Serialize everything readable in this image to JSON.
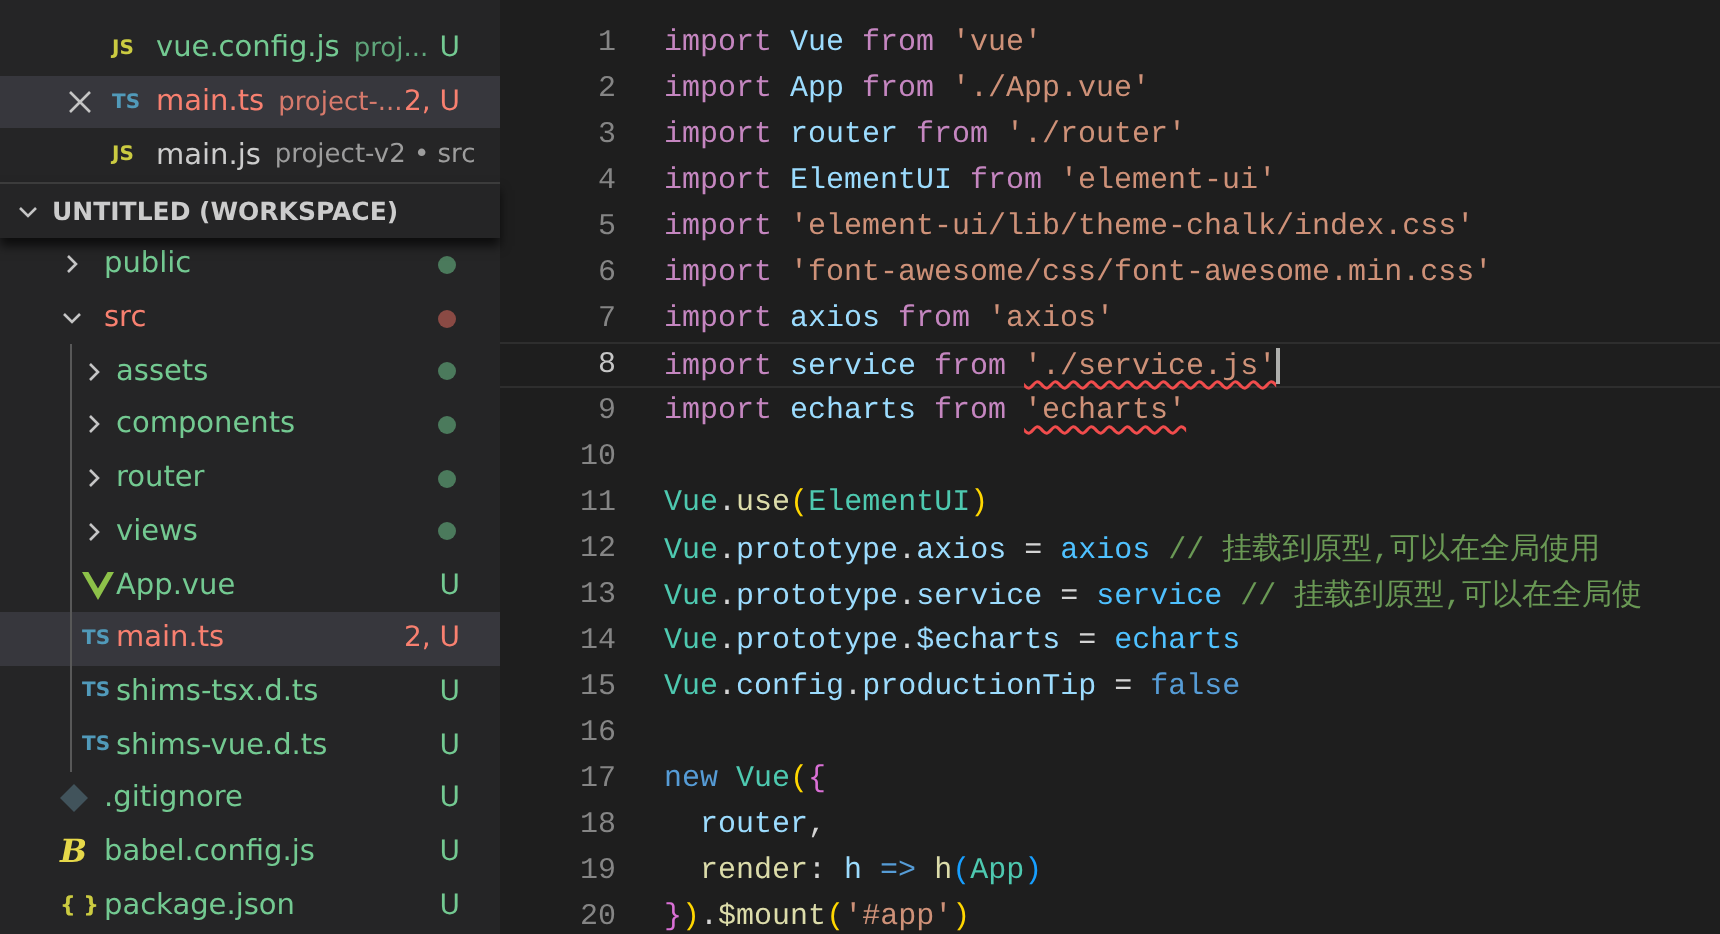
{
  "open_editors": [
    {
      "kind": "js",
      "icon_text": "JS",
      "name": "vue.config.js",
      "path": "proj...",
      "status": "U",
      "error": false,
      "selected": false,
      "closable": false
    },
    {
      "kind": "ts",
      "icon_text": "TS",
      "name": "main.ts",
      "path": "project-...",
      "status": "2, U",
      "error": true,
      "selected": true,
      "closable": true
    },
    {
      "kind": "js",
      "icon_text": "JS",
      "name": "main.js",
      "path": "project-v2 • src",
      "error": false,
      "selected": false,
      "closable": false
    }
  ],
  "workspace": {
    "title": "UNTITLED (WORKSPACE)",
    "expanded": true,
    "items": [
      {
        "kind": "folder",
        "name": "public",
        "expanded": false,
        "error": false,
        "color": "#4b7a5c",
        "selected": false
      },
      {
        "kind": "folder",
        "name": "src",
        "expanded": true,
        "error": true,
        "color": "#8a4a44",
        "selected": false,
        "children": [
          {
            "kind": "folder",
            "name": "assets",
            "expanded": false,
            "error": false,
            "color": "#4b7a5c",
            "selected": false
          },
          {
            "kind": "folder",
            "name": "components",
            "expanded": false,
            "error": false,
            "color": "#4b7a5c",
            "selected": false
          },
          {
            "kind": "folder",
            "name": "router",
            "expanded": false,
            "error": false,
            "color": "#4b7a5c",
            "selected": false
          },
          {
            "kind": "folder",
            "name": "views",
            "expanded": false,
            "error": false,
            "color": "#4b7a5c",
            "selected": false
          },
          {
            "kind": "vue",
            "name": "App.vue",
            "status": "U",
            "error": false,
            "selected": false
          },
          {
            "kind": "ts",
            "icon_text": "TS",
            "name": "main.ts",
            "status": "2, U",
            "error": true,
            "selected": true
          },
          {
            "kind": "ts",
            "icon_text": "TS",
            "name": "shims-tsx.d.ts",
            "status": "U",
            "error": false,
            "selected": false
          },
          {
            "kind": "ts",
            "icon_text": "TS",
            "name": "shims-vue.d.ts",
            "status": "U",
            "error": false,
            "selected": false
          }
        ]
      },
      {
        "kind": "git",
        "name": ".gitignore",
        "status": "U",
        "error": false,
        "selected": false
      },
      {
        "kind": "babel",
        "icon_text": "B",
        "name": "babel.config.js",
        "status": "U",
        "error": false,
        "selected": false
      },
      {
        "kind": "json",
        "icon_text": "{ }",
        "name": "package.json",
        "status": "U",
        "error": false,
        "selected": false
      }
    ]
  },
  "editor": {
    "lines": [
      {
        "number": "1",
        "current": false,
        "tokens": [
          {
            "kind": "kw",
            "t": "import "
          },
          {
            "kind": "var",
            "t": "Vue"
          },
          {
            "kind": "kw",
            "t": " from "
          },
          {
            "kind": "str",
            "t": "'vue'"
          }
        ]
      },
      {
        "number": "2",
        "current": false,
        "tokens": [
          {
            "kind": "kw",
            "t": "import "
          },
          {
            "kind": "var",
            "t": "App"
          },
          {
            "kind": "kw",
            "t": " from "
          },
          {
            "kind": "str",
            "t": "'./App.vue'"
          }
        ]
      },
      {
        "number": "3",
        "current": false,
        "tokens": [
          {
            "kind": "kw",
            "t": "import "
          },
          {
            "kind": "var",
            "t": "router"
          },
          {
            "kind": "kw",
            "t": " from "
          },
          {
            "kind": "str",
            "t": "'./router'"
          }
        ]
      },
      {
        "number": "4",
        "current": false,
        "tokens": [
          {
            "kind": "kw",
            "t": "import "
          },
          {
            "kind": "var",
            "t": "ElementUI"
          },
          {
            "kind": "kw",
            "t": " from "
          },
          {
            "kind": "str",
            "t": "'element-ui'"
          }
        ]
      },
      {
        "number": "5",
        "current": false,
        "tokens": [
          {
            "kind": "kw",
            "t": "import "
          },
          {
            "kind": "str",
            "t": "'element-ui/lib/theme-chalk/index.css'"
          }
        ]
      },
      {
        "number": "6",
        "current": false,
        "tokens": [
          {
            "kind": "kw",
            "t": "import "
          },
          {
            "kind": "str",
            "t": "'font-awesome/css/font-awesome.min.css'"
          }
        ]
      },
      {
        "number": "7",
        "current": false,
        "tokens": [
          {
            "kind": "kw",
            "t": "import "
          },
          {
            "kind": "var",
            "t": "axios"
          },
          {
            "kind": "kw",
            "t": " from "
          },
          {
            "kind": "str",
            "t": "'axios'"
          }
        ]
      },
      {
        "number": "8",
        "current": true,
        "tokens": [
          {
            "kind": "kw",
            "t": "import "
          },
          {
            "kind": "var",
            "t": "service"
          },
          {
            "kind": "kw",
            "t": " from "
          },
          {
            "kind": "str",
            "t": "'./service.js'",
            "error": true
          }
        ]
      },
      {
        "number": "9",
        "current": false,
        "tokens": [
          {
            "kind": "kw",
            "t": "import "
          },
          {
            "kind": "var",
            "t": "echarts"
          },
          {
            "kind": "kw",
            "t": " from "
          },
          {
            "kind": "str",
            "t": "'echarts'",
            "error": true
          }
        ]
      },
      {
        "number": "10",
        "current": false
      },
      {
        "number": "11",
        "current": false,
        "tokens": [
          {
            "kind": "cls",
            "t": "Vue"
          },
          {
            "kind": "p",
            "t": "."
          },
          {
            "kind": "fn",
            "t": "use"
          },
          {
            "kind": "b1",
            "t": "("
          },
          {
            "kind": "cls",
            "t": "ElementUI"
          },
          {
            "kind": "b1",
            "t": ")"
          }
        ]
      },
      {
        "number": "12",
        "current": false,
        "tokens": [
          {
            "kind": "cls",
            "t": "Vue"
          },
          {
            "kind": "p",
            "t": "."
          },
          {
            "kind": "var",
            "t": "prototype"
          },
          {
            "kind": "p",
            "t": "."
          },
          {
            "kind": "var",
            "t": "axios"
          },
          {
            "kind": "p",
            "t": " = "
          },
          {
            "kind": "var2",
            "t": "axios"
          },
          {
            "kind": "cm",
            "t": " // 挂载到原型,可以在全局使用"
          }
        ]
      },
      {
        "number": "13",
        "current": false,
        "tokens": [
          {
            "kind": "cls",
            "t": "Vue"
          },
          {
            "kind": "p",
            "t": "."
          },
          {
            "kind": "var",
            "t": "prototype"
          },
          {
            "kind": "p",
            "t": "."
          },
          {
            "kind": "var",
            "t": "service"
          },
          {
            "kind": "p",
            "t": " = "
          },
          {
            "kind": "var2",
            "t": "service"
          },
          {
            "kind": "cm",
            "t": " // 挂载到原型,可以在全局使"
          }
        ]
      },
      {
        "number": "14",
        "current": false,
        "tokens": [
          {
            "kind": "cls",
            "t": "Vue"
          },
          {
            "kind": "p",
            "t": "."
          },
          {
            "kind": "var",
            "t": "prototype"
          },
          {
            "kind": "p",
            "t": "."
          },
          {
            "kind": "var",
            "t": "$echarts"
          },
          {
            "kind": "p",
            "t": " = "
          },
          {
            "kind": "var2",
            "t": "echarts"
          }
        ]
      },
      {
        "number": "15",
        "current": false,
        "tokens": [
          {
            "kind": "cls",
            "t": "Vue"
          },
          {
            "kind": "p",
            "t": "."
          },
          {
            "kind": "var",
            "t": "config"
          },
          {
            "kind": "p",
            "t": "."
          },
          {
            "kind": "var",
            "t": "productionTip"
          },
          {
            "kind": "p",
            "t": " = "
          },
          {
            "kind": "bool",
            "t": "false"
          }
        ]
      },
      {
        "number": "16",
        "current": false
      },
      {
        "number": "17",
        "current": false,
        "tokens": [
          {
            "kind": "bool",
            "t": "new "
          },
          {
            "kind": "cls",
            "t": "Vue"
          },
          {
            "kind": "b1",
            "t": "("
          },
          {
            "kind": "b2",
            "t": "{"
          }
        ]
      },
      {
        "number": "18",
        "current": false,
        "tokens": [
          {
            "kind": "var",
            "t": "  router"
          },
          {
            "kind": "p",
            "t": ","
          }
        ]
      },
      {
        "number": "19",
        "current": false,
        "tokens": [
          {
            "kind": "fn",
            "t": "  render"
          },
          {
            "kind": "p",
            "t": ": "
          },
          {
            "kind": "var",
            "t": "h"
          },
          {
            "kind": "bool",
            "t": " => "
          },
          {
            "kind": "fn",
            "t": "h"
          },
          {
            "kind": "b3",
            "t": "("
          },
          {
            "kind": "cls",
            "t": "App"
          },
          {
            "kind": "b3",
            "t": ")"
          }
        ]
      },
      {
        "number": "20",
        "current": false,
        "tokens": [
          {
            "kind": "b2",
            "t": "}"
          },
          {
            "kind": "b1",
            "t": ")"
          },
          {
            "kind": "p",
            "t": "."
          },
          {
            "kind": "fn",
            "t": "$mount"
          },
          {
            "kind": "b1",
            "t": "("
          },
          {
            "kind": "str",
            "t": "'#app'"
          },
          {
            "kind": "b1",
            "t": ")"
          }
        ]
      }
    ]
  }
}
